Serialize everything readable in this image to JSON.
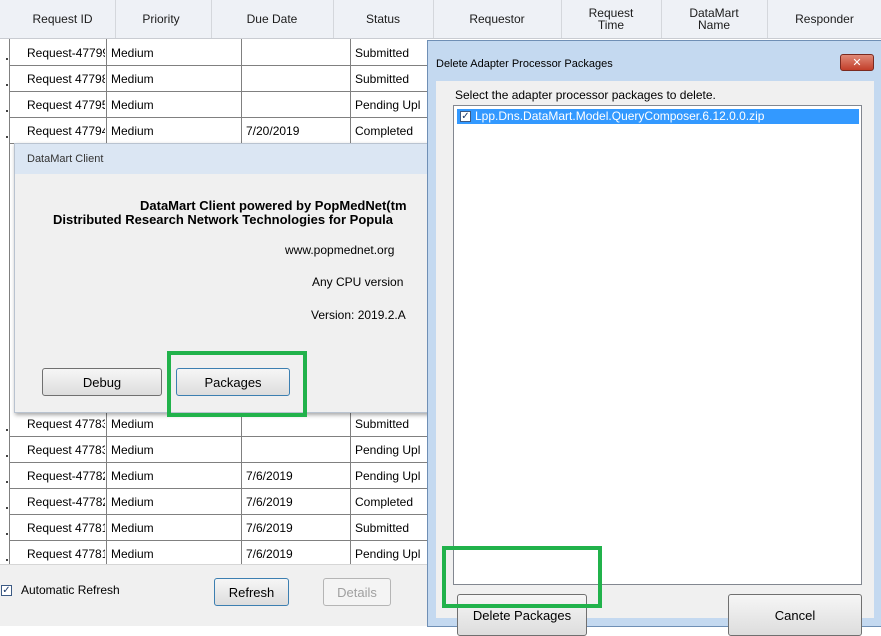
{
  "grid": {
    "headers": [
      {
        "label": "Request ID"
      },
      {
        "label": "Priority"
      },
      {
        "label": "Due Date"
      },
      {
        "label": "Status"
      },
      {
        "label": "Requestor"
      },
      {
        "label": "Request\nTime"
      },
      {
        "label": "DataMart\nName"
      },
      {
        "label": "Responder"
      }
    ],
    "rows_top": [
      {
        "id": "Request-47799",
        "priority": "Medium",
        "due": "",
        "status": "Submitted"
      },
      {
        "id": "Request 47798",
        "priority": "Medium",
        "due": "",
        "status": "Submitted"
      },
      {
        "id": "Request 47795",
        "priority": "Medium",
        "due": "",
        "status": "Pending Upl"
      },
      {
        "id": "Request 47794",
        "priority": "Medium",
        "due": "7/20/2019",
        "status": "Completed"
      }
    ],
    "rows_bottom": [
      {
        "id": "Request 47783",
        "priority": "Medium",
        "due": "",
        "status": "Submitted"
      },
      {
        "id": "Request 47783",
        "priority": "Medium",
        "due": "",
        "status": "Pending Upl"
      },
      {
        "id": "Request-47782",
        "priority": "Medium",
        "due": "7/6/2019",
        "status": "Pending Upl"
      },
      {
        "id": "Request-47782",
        "priority": "Medium",
        "due": "7/6/2019",
        "status": "Completed"
      },
      {
        "id": "Request 47781",
        "priority": "Medium",
        "due": "7/6/2019",
        "status": "Submitted"
      },
      {
        "id": "Request 47781",
        "priority": "Medium",
        "due": "7/6/2019",
        "status": "Pending Upl"
      }
    ]
  },
  "bottombar": {
    "auto_refresh_label": "Automatic Refresh",
    "auto_refresh_checked": true,
    "refresh_label": "Refresh",
    "details_label": "Details"
  },
  "about": {
    "title": "DataMart Client",
    "line1": "DataMart Client powered by PopMedNet(tm",
    "line2": "Distributed Research Network Technologies for Popula",
    "website": "www.popmednet.org",
    "cpu": "Any CPU version",
    "version": "Version: 2019.2.A",
    "debug_label": "Debug",
    "packages_label": "Packages"
  },
  "delete_dialog": {
    "title": "Delete Adapter Processor Packages",
    "close_glyph": "✕",
    "instruction": "Select the adapter processor packages to delete.",
    "packages": [
      {
        "name": "Lpp.Dns.DataMart.Model.QueryComposer.6.12.0.0.zip",
        "checked": true
      }
    ],
    "delete_label": "Delete Packages",
    "cancel_label": "Cancel"
  },
  "colors": {
    "highlight": "#21b24b",
    "selection": "#3399ff",
    "title_bar": "#c4d9f0"
  }
}
